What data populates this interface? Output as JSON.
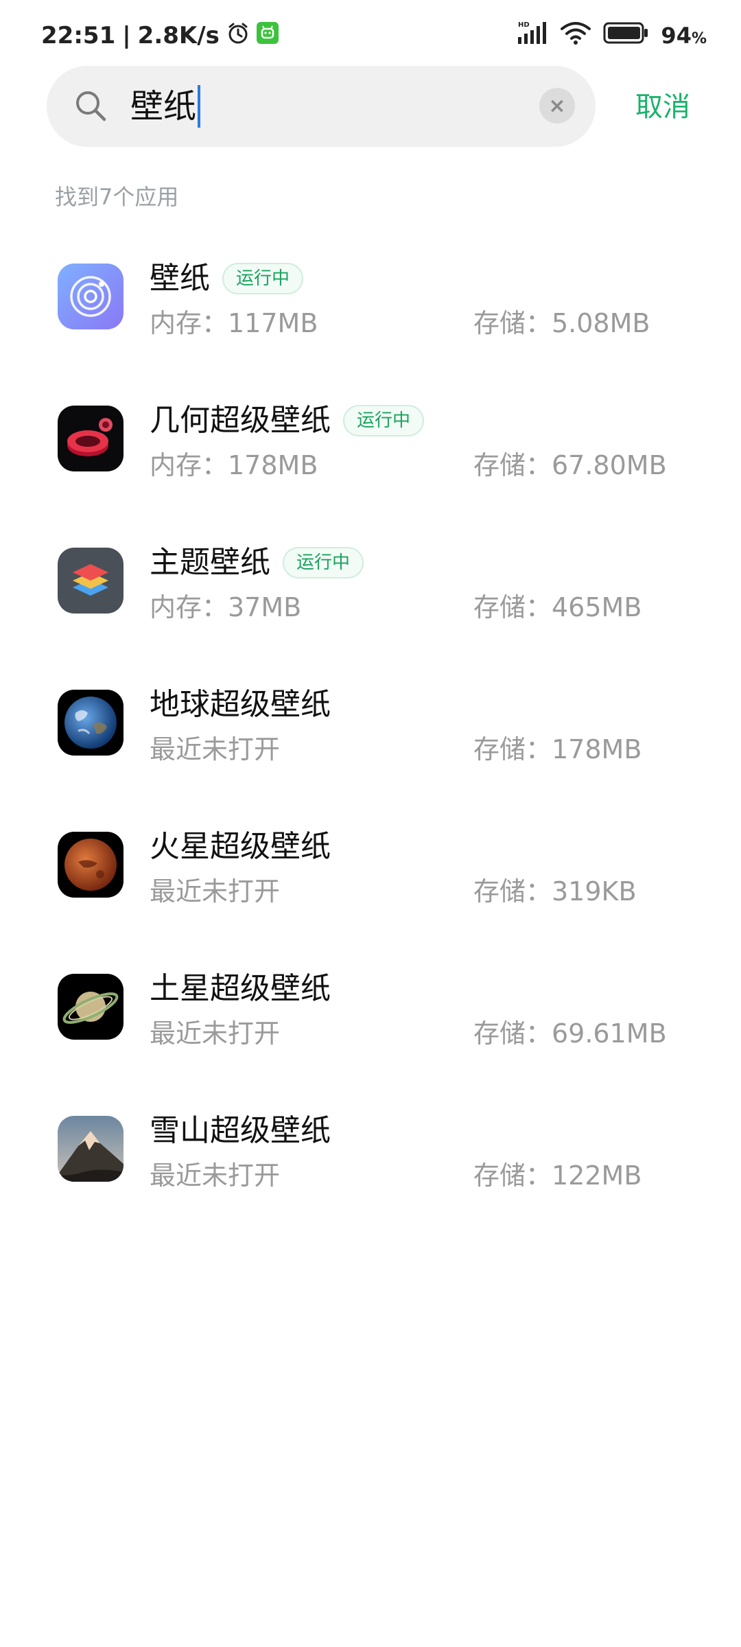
{
  "status_bar": {
    "time": "22:51",
    "speed": "2.8K/s",
    "battery": "94",
    "battery_unit": "%",
    "hd_label": "HD"
  },
  "search": {
    "query": "壁纸",
    "cancel_label": "取消"
  },
  "result_count": "找到7个应用",
  "apps": [
    {
      "name": "壁纸",
      "running": true,
      "badge": "运行中",
      "mem": "内存：117MB",
      "store": "存储：5.08MB"
    },
    {
      "name": "几何超级壁纸",
      "running": true,
      "badge": "运行中",
      "mem": "内存：178MB",
      "store": "存储：67.80MB"
    },
    {
      "name": "主题壁纸",
      "running": true,
      "badge": "运行中",
      "mem": "内存：37MB",
      "store": "存储：465MB"
    },
    {
      "name": "地球超级壁纸",
      "running": false,
      "mem": "最近未打开",
      "store": "存储：178MB"
    },
    {
      "name": "火星超级壁纸",
      "running": false,
      "mem": "最近未打开",
      "store": "存储：319KB"
    },
    {
      "name": "土星超级壁纸",
      "running": false,
      "mem": "最近未打开",
      "store": "存储：69.61MB"
    },
    {
      "name": "雪山超级壁纸",
      "running": false,
      "mem": "最近未打开",
      "store": "存储：122MB"
    }
  ],
  "colors": {
    "accent_green": "#19b36b",
    "caret_blue": "#2a7ae2"
  }
}
